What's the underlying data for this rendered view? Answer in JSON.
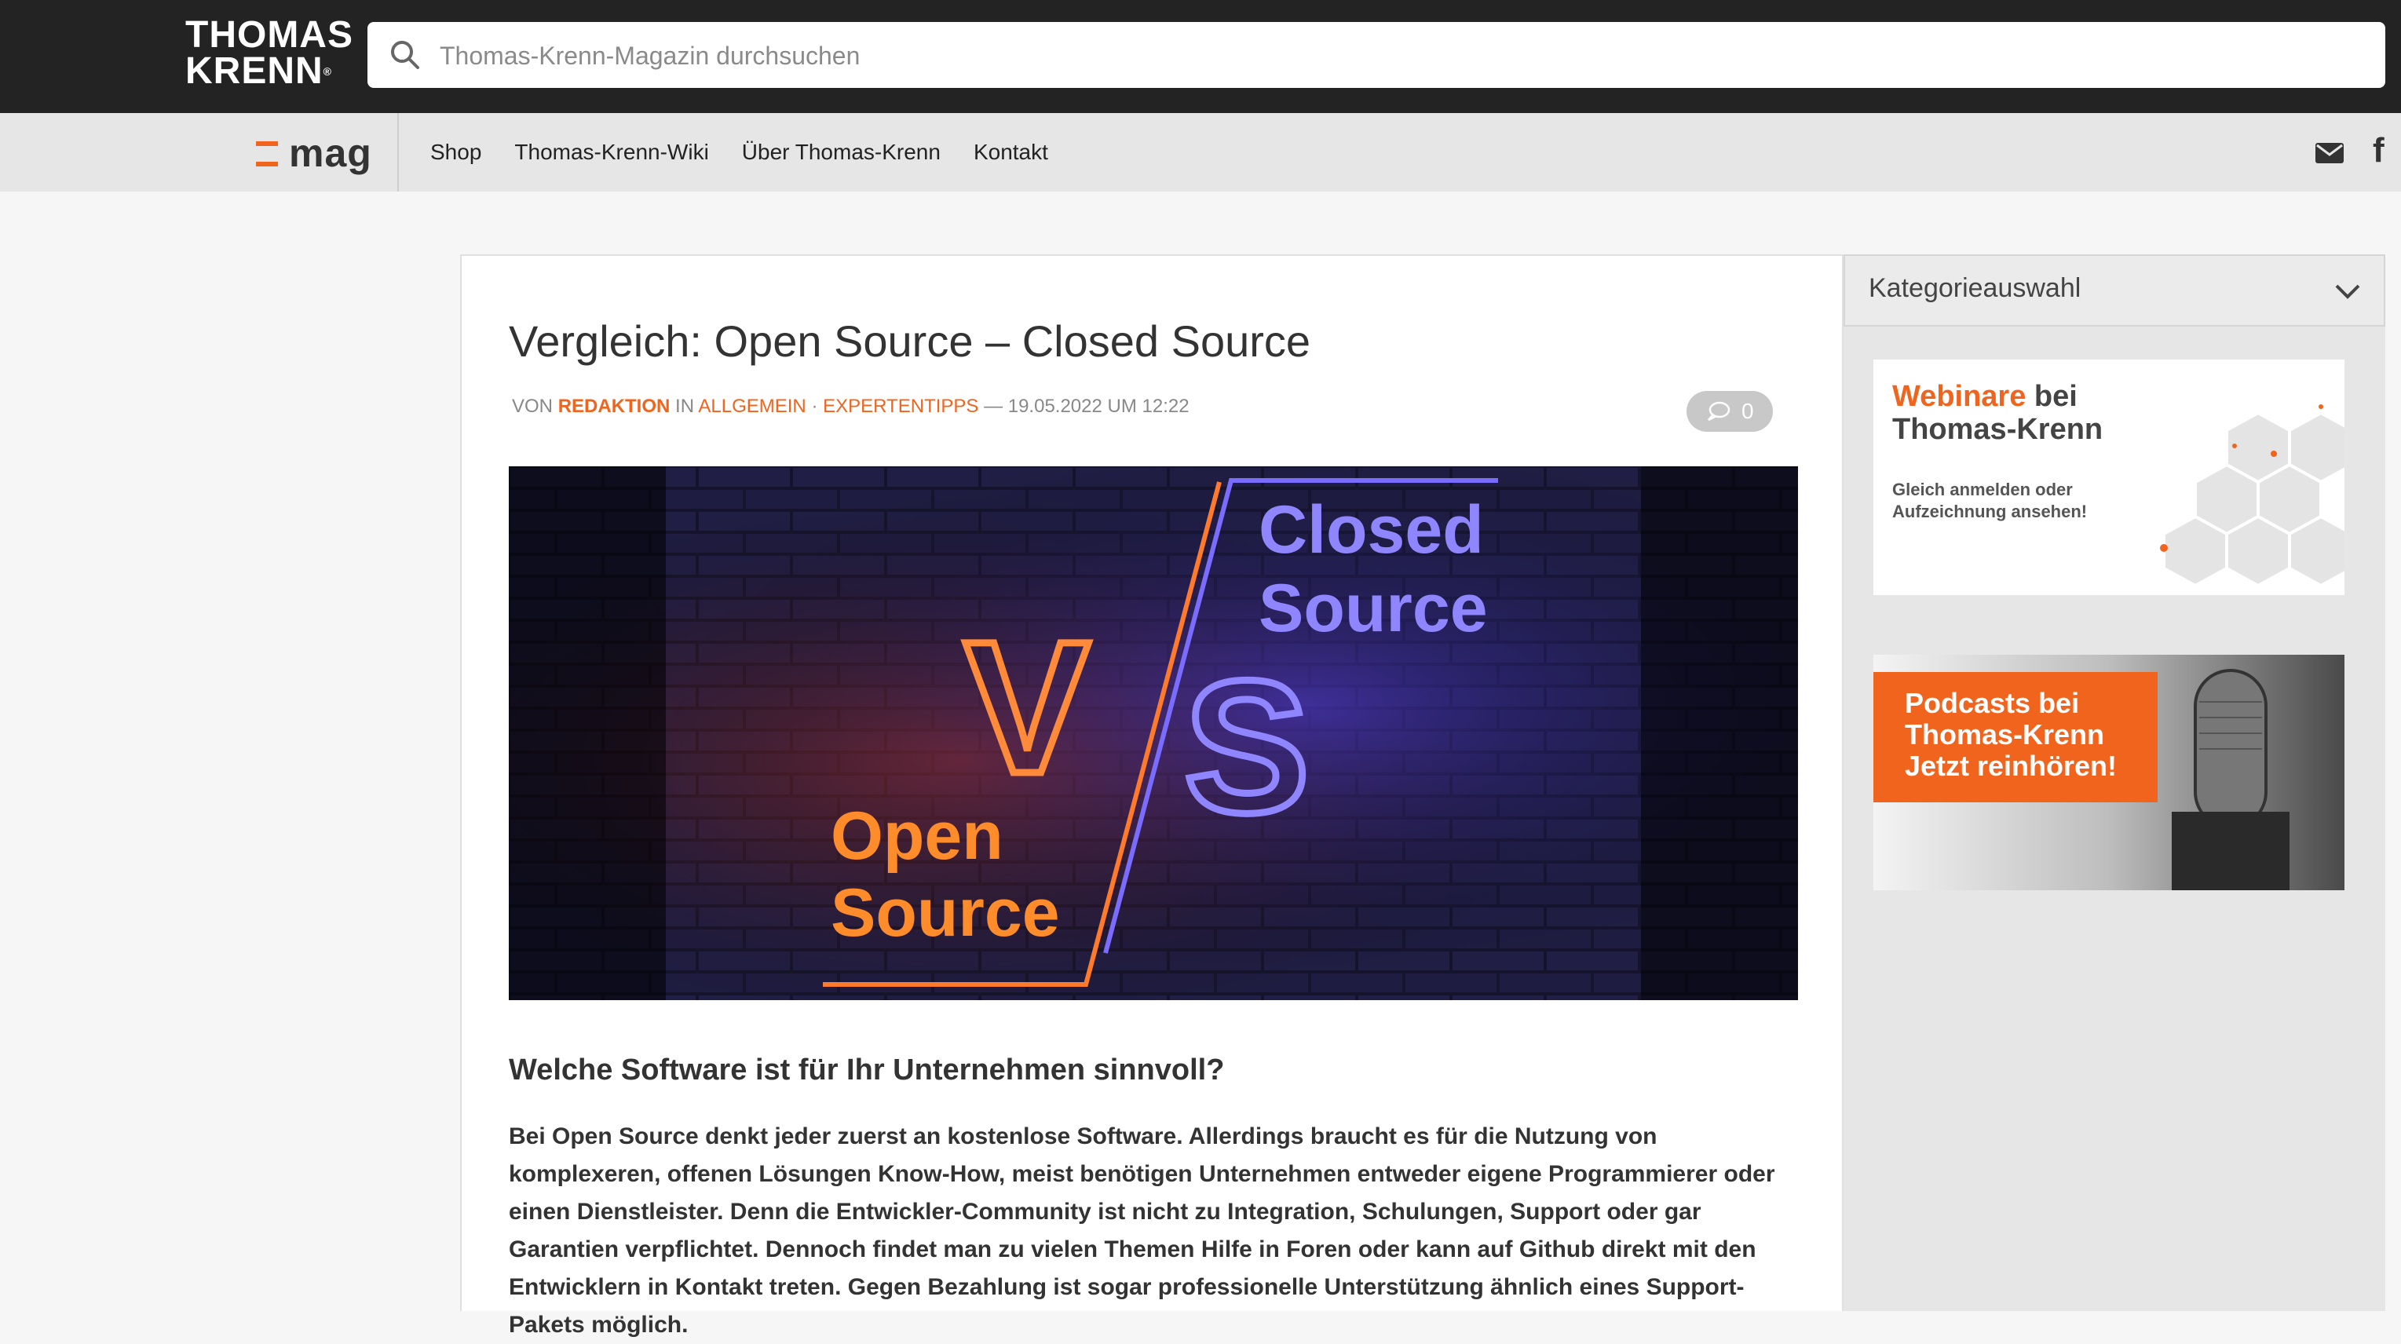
{
  "header": {
    "logo_line1": "THOMAS",
    "logo_line2": "KRENN",
    "logo_reg": "®",
    "search_placeholder": "Thomas-Krenn-Magazin durchsuchen"
  },
  "nav": {
    "brand": "mag",
    "links": [
      "Shop",
      "Thomas-Krenn-Wiki",
      "Über Thomas-Krenn",
      "Kontakt"
    ],
    "icons": [
      "mail-icon",
      "facebook-icon"
    ]
  },
  "article": {
    "title": "Vergleich: Open Source – Closed Source",
    "meta": {
      "by": "VON",
      "author": "REDAKTION",
      "in": "IN",
      "category1": "ALLGEMEIN",
      "separator": "·",
      "category2": "EXPERTENTIPPS",
      "dash": "—",
      "date": "19.05.2022 UM 12:22"
    },
    "comment_count": "0",
    "hero": {
      "left_word1": "Open",
      "left_word2": "Source",
      "right_word1": "Closed",
      "right_word2": "Source",
      "v": "V",
      "s": "S"
    },
    "subheading": "Welche Software ist für Ihr Unternehmen sinnvoll?",
    "paragraph": "Bei Open Source denkt jeder zuerst an kostenlose Software. Allerdings braucht es für die Nutzung von komplexeren, offenen Lösungen Know-How, meist benötigen Unternehmen entweder eigene Programmierer oder einen Dienstleister. Denn die Entwickler-Community ist nicht zu Integration, Schulungen, Support oder gar Garantien verpflichtet. Dennoch findet man zu vielen Themen Hilfe in Foren oder kann auf Github direkt mit den Entwicklern in Kontakt treten. Gegen Bezahlung ist sogar professionelle Unterstützung ähnlich eines Support-Pakets möglich."
  },
  "sidebar": {
    "category_label": "Kategorieauswahl",
    "banner1": {
      "highlight": "Webinare",
      "title_rest": "bei",
      "title_line2": "Thomas-Krenn",
      "sub_line1": "Gleich anmelden oder",
      "sub_line2": "Aufzeichnung ansehen!"
    },
    "banner2": {
      "line1": "Podcasts bei",
      "line2": "Thomas-Krenn",
      "line3": "Jetzt reinhören!"
    }
  },
  "colors": {
    "accent": "#f0641e",
    "topbar": "#232323",
    "navbar": "#e6e6e6"
  }
}
